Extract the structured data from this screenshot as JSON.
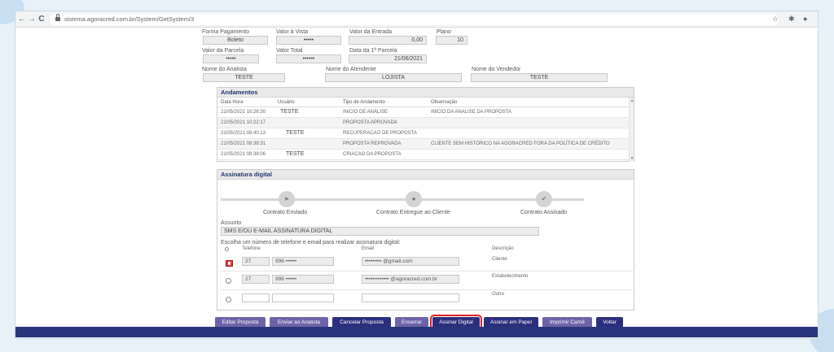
{
  "browser": {
    "url": "sistema.agoracred.com.br/System/GetSystem/3",
    "back_glyph": "←",
    "forward_glyph": "→",
    "reload_glyph": "C",
    "star_glyph": "☆",
    "extensions_glyph": "✱",
    "profile_glyph": "●"
  },
  "summary": {
    "forma_pagamento": {
      "label": "Forma Pagamento",
      "value": "Boleto"
    },
    "valor_vista": {
      "label": "Valor à Vista",
      "value": "•••••"
    },
    "valor_entrada": {
      "label": "Valor da Entrada",
      "value": "0,00"
    },
    "plano": {
      "label": "Plano",
      "value": "10"
    },
    "valor_parcela": {
      "label": "Valor da Parcela",
      "value": "•••••"
    },
    "valor_total": {
      "label": "Valor Total",
      "value": "••••••"
    },
    "data_parcela": {
      "label": "Data da 1ª Parcela",
      "value": "21/06/2021"
    },
    "analista": {
      "label": "Nome do Analista",
      "value": "TESTE"
    },
    "atendente": {
      "label": "Nome do Atendente",
      "value": "LOJISTA"
    },
    "vendedor": {
      "label": "Nome do Vendedor",
      "value": "TESTE"
    }
  },
  "andamentos": {
    "title": "Andamentos",
    "columns": [
      "Data Hora",
      "Usuário",
      "Tipo de Andamento",
      "Observação"
    ],
    "rows": [
      {
        "data": "21/05/2021 10:26:30",
        "usuario": "TESTE",
        "tipo": "INICIO DE ANÁLISE",
        "obs": "INICIO DA ANALISE DA PROPOSTA"
      },
      {
        "data": "21/05/2021 10:22:17",
        "usuario": "",
        "tipo": "PROPOSTA APROVADA",
        "obs": ""
      },
      {
        "data": "21/05/2021 08:40:13",
        "usuario": "TESTE",
        "tipo": "RECUPERACAO DE PROPOSTA",
        "obs": ""
      },
      {
        "data": "21/05/2021 08:38:31",
        "usuario": "",
        "tipo": "PROPOSTA REPROVADA",
        "obs": "CLIENTE SEM HISTÓRICO NA AGORACRED FORA DA POLÍTICA DE CRÉDITO"
      },
      {
        "data": "21/05/2021 08:38:06",
        "usuario": "TESTE",
        "tipo": "CRIACAO DA PROPOSTA",
        "obs": ""
      }
    ]
  },
  "assinatura": {
    "title": "Assinatura digital",
    "steps": [
      {
        "label": "Contrato Enviado",
        "icon": "➤"
      },
      {
        "label": "Contrato Entregue ao Cliente",
        "icon": "●"
      },
      {
        "label": "Contrato Assinado",
        "icon": "✔"
      }
    ],
    "assunto_label": "Assunto",
    "assunto_value": "SMS E/OU E-MAIL ASSINATURA DIGITAL",
    "instruction": "Escolha um número de telefone e email para realizar assinatura digital:",
    "col_telefone": "Telefone",
    "col_email": "Email",
    "col_descricao": "Descrição",
    "options": [
      {
        "ddd": "27",
        "phone": "996 ••••••",
        "email": "••••••••• @gmail.com",
        "descricao": "Cliente",
        "selected": true
      },
      {
        "ddd": "27",
        "phone": "998 ••••••",
        "email": "••••••••••••• @agoracred.com.br",
        "descricao": "Estabelecimento",
        "selected": false
      },
      {
        "ddd": "",
        "phone": "",
        "email": "",
        "descricao": "Outro",
        "selected": false
      }
    ]
  },
  "buttons": [
    {
      "label": "Editar Proposta",
      "style": "lilac"
    },
    {
      "label": "Enviar ao Analista",
      "style": "lilac"
    },
    {
      "label": "Cancelar Proposta",
      "style": "navy"
    },
    {
      "label": "Encerrar",
      "style": "lilac"
    },
    {
      "label": "Assinar Digital",
      "style": "navy",
      "highlighted": true
    },
    {
      "label": "Assinar em Papel",
      "style": "navy"
    },
    {
      "label": "Imprimir Carnê",
      "style": "lilac"
    },
    {
      "label": "Voltar",
      "style": "navy"
    }
  ],
  "colors": {
    "navy": "#2b2f7d",
    "lilac": "#6e63a8",
    "highlight": "#e02020",
    "footer": "#27367c"
  }
}
